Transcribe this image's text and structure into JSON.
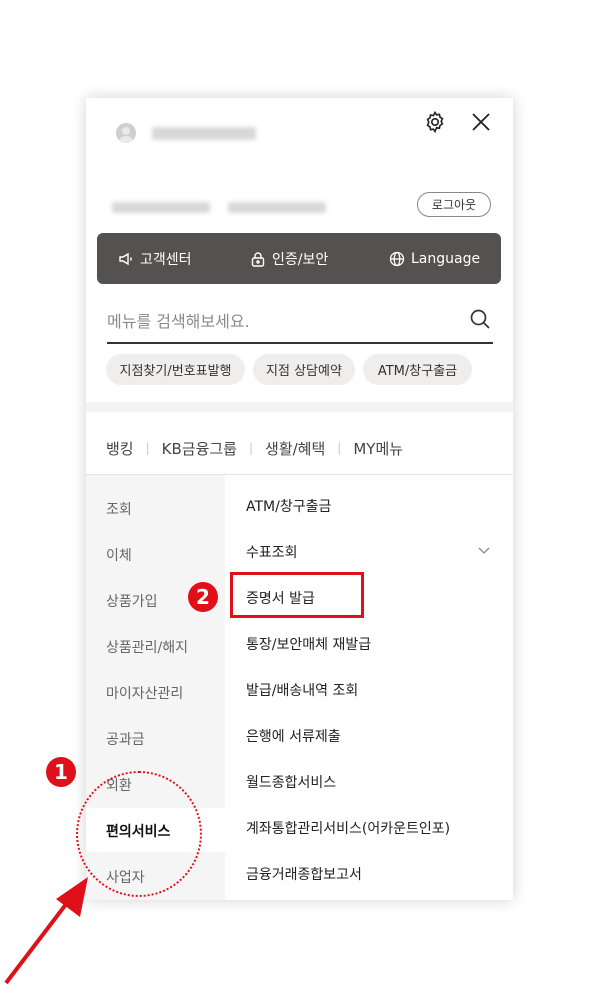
{
  "header": {
    "logout_label": "로그아웃",
    "settings_icon": "gear-icon",
    "close_icon": "close-icon"
  },
  "quickbar": {
    "items": [
      {
        "label": "고객센터",
        "icon": "megaphone-icon"
      },
      {
        "label": "인증/보안",
        "icon": "lock-icon"
      },
      {
        "label": "Language",
        "icon": "globe-icon"
      }
    ]
  },
  "search": {
    "placeholder": "메뉴를 검색해보세요.",
    "icon": "search-icon"
  },
  "chips": [
    "지점찾기/번호표발행",
    "지점 상담예약",
    "ATM/창구출금"
  ],
  "tabs": [
    "뱅킹",
    "KB금융그룹",
    "생활/혜택",
    "MY메뉴"
  ],
  "left_menu": {
    "items": [
      "조회",
      "이체",
      "상품가입",
      "상품관리/해지",
      "마이자산관리",
      "공과금",
      "외환",
      "편의서비스",
      "사업자"
    ],
    "active": "편의서비스"
  },
  "right_menu": {
    "items": [
      "ATM/창구출금",
      "수표조회",
      "증명서 발급",
      "통장/보안매체 재발급",
      "발급/배송내역 조회",
      "은행에 서류제출",
      "월드종합서비스",
      "계좌통합관리서비스(어카운트인포)",
      "금융거래종합보고서"
    ],
    "highlighted": "증명서 발급"
  },
  "annotations": {
    "step1": "1",
    "step2": "2",
    "accent_color": "#e0101a"
  }
}
